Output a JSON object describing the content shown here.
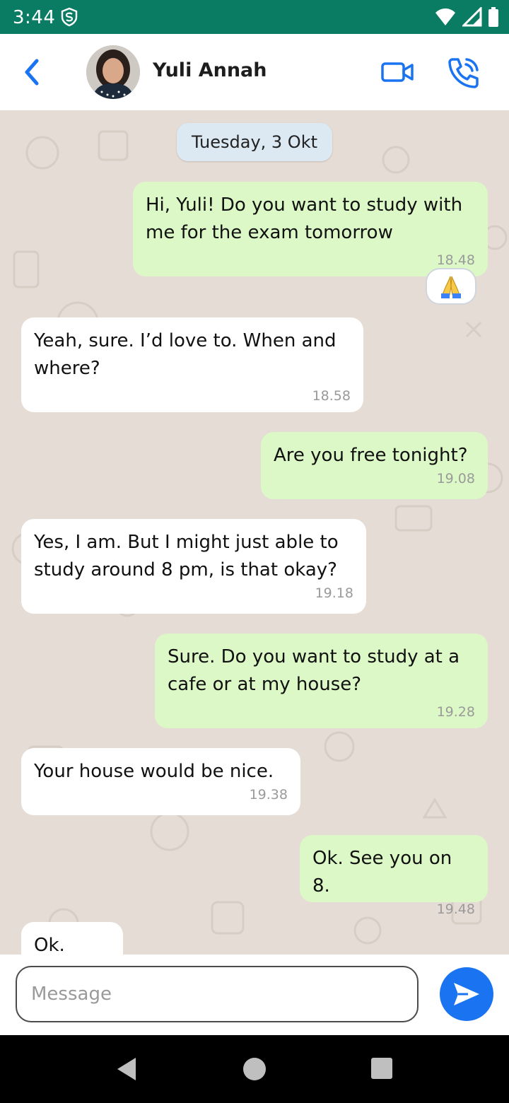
{
  "status_bar": {
    "time": "3:44",
    "app_icon": "shield-s-icon",
    "icons": [
      "wifi-icon",
      "signal-icon",
      "battery-icon"
    ],
    "color": "#0a7c64"
  },
  "header": {
    "back_icon": "chevron-left-icon",
    "contact_name": "Yuli Annah",
    "video_icon": "video-camera-icon",
    "call_icon": "phone-call-icon",
    "accent": "#1a73f0"
  },
  "chat": {
    "date_label": "Tuesday, 3 Okt",
    "messages": [
      {
        "direction": "out",
        "text": "Hi, Yuli! Do you want to study with me for the exam tomorrow",
        "time": "18.48"
      },
      {
        "direction": "in",
        "text": "Yeah, sure. I’d love to. When and where?",
        "time": "18.58"
      },
      {
        "direction": "out",
        "text": "Are you free tonight?",
        "time": "19.08"
      },
      {
        "direction": "in",
        "text": "Yes, I am. But I might just able to study around 8 pm, is that okay?",
        "time": "19.18"
      },
      {
        "direction": "out",
        "text": "Sure. Do you want to study at a cafe or at my house?",
        "time": "19.28"
      },
      {
        "direction": "in",
        "text": "Your house would be nice.",
        "time": "19.38"
      },
      {
        "direction": "out",
        "text": "Ok. See you on 8.",
        "time": "19.48"
      },
      {
        "direction": "in",
        "text": "Ok.",
        "time": ""
      }
    ],
    "reaction": {
      "emoji": "folded-hands-icon"
    },
    "colors": {
      "outgoing": "#dcf8c6",
      "incoming": "#ffffff",
      "wallpaper": "#e5ddd5"
    }
  },
  "composer": {
    "placeholder": "Message",
    "send_icon": "send-arrow-icon"
  },
  "nav": {
    "back_icon": "triangle-back-icon",
    "home_icon": "circle-home-icon",
    "recents_icon": "square-recents-icon"
  }
}
